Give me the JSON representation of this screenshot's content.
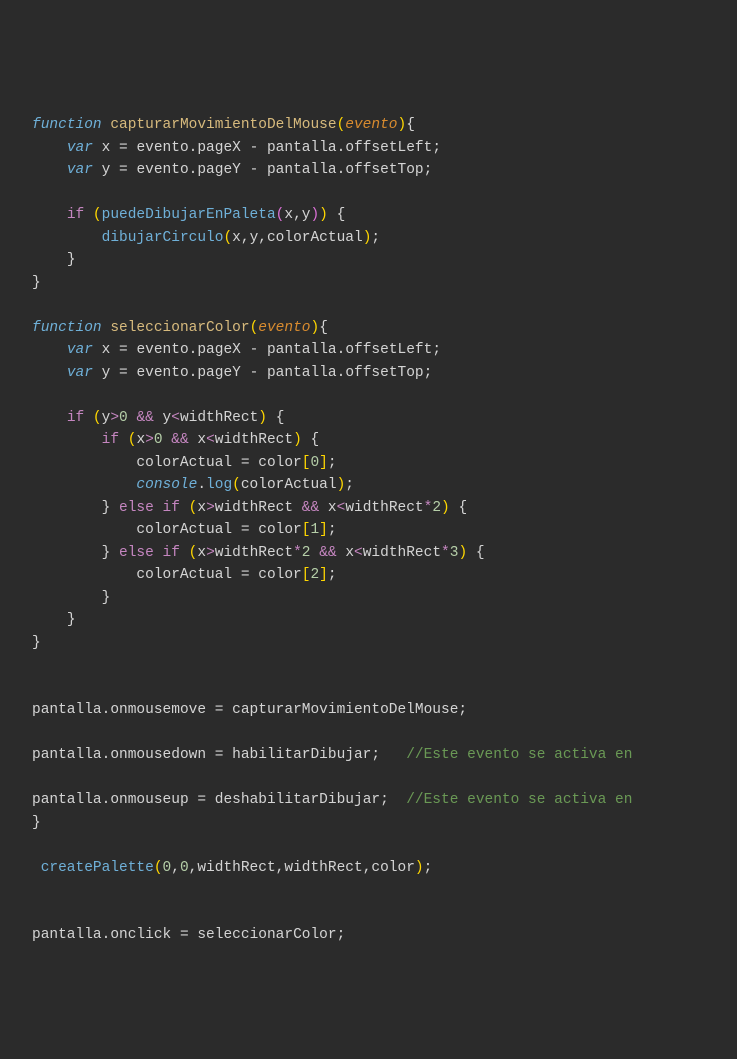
{
  "code": {
    "fn1": {
      "kw_function": "function",
      "name": "capturarMovimientoDelMouse",
      "param": "evento",
      "l2_var": "var",
      "l2_x": "x",
      "l2_eq": " = ",
      "l2_evento": "evento",
      "l2_dot1": ".",
      "l2_pageX": "pageX",
      "l2_minus": " - ",
      "l2_pantalla": "pantalla",
      "l2_dot2": ".",
      "l2_offsetLeft": "offsetLeft",
      "l2_semi": ";",
      "l3_var": "var",
      "l3_y": "y",
      "l3_evento": "evento",
      "l3_pageY": "pageY",
      "l3_pantalla": "pantalla",
      "l3_offsetTop": "offsetTop",
      "l5_if": "if",
      "l5_fn": "puedeDibujarEnPaleta",
      "l5_x": "x",
      "l5_comma": ",",
      "l5_y": "y",
      "l6_fn": "dibujarCirculo",
      "l6_x": "x",
      "l6_y": "y",
      "l6_colorActual": "colorActual"
    },
    "fn2": {
      "kw_function": "function",
      "name": "seleccionarColor",
      "param": "evento",
      "l2_var": "var",
      "l2_x": "x",
      "l2_evento": "evento",
      "l2_pageX": "pageX",
      "l2_pantalla": "pantalla",
      "l2_offsetLeft": "offsetLeft",
      "l3_var": "var",
      "l3_y": "y",
      "l3_evento": "evento",
      "l3_pageY": "pageY",
      "l3_pantalla": "pantalla",
      "l3_offsetTop": "offsetTop",
      "l5_if": "if",
      "l5_y1": "y",
      "l5_gt": ">",
      "l5_zero": "0",
      "l5_and": "&&",
      "l5_y2": "y",
      "l5_lt": "<",
      "l5_widthRect": "widthRect",
      "l6_if": "if",
      "l6_x1": "x",
      "l6_zero": "0",
      "l6_x2": "x",
      "l6_widthRect": "widthRect",
      "l7_colorActual": "colorActual",
      "l7_color": "color",
      "l7_idx": "0",
      "l8_console": "console",
      "l8_log": "log",
      "l8_arg": "colorActual",
      "l9_else": "else",
      "l9_if": "if",
      "l9_x1": "x",
      "l9_widthRect1": "widthRect",
      "l9_x2": "x",
      "l9_widthRect2": "widthRect",
      "l9_mul": "*",
      "l9_two": "2",
      "l10_colorActual": "colorActual",
      "l10_color": "color",
      "l10_idx": "1",
      "l11_else": "else",
      "l11_if": "if",
      "l11_x1": "x",
      "l11_widthRect1": "widthRect",
      "l11_two": "2",
      "l11_x2": "x",
      "l11_widthRect2": "widthRect",
      "l11_three": "3",
      "l12_colorActual": "colorActual",
      "l12_color": "color",
      "l12_idx": "2"
    },
    "tail": {
      "l1_pantalla": "pantalla",
      "l1_onmousemove": "onmousemove",
      "l1_fn": "capturarMovimientoDelMouse",
      "l2_pantalla": "pantalla",
      "l2_onmousedown": "onmousedown",
      "l2_fn": "habilitarDibujar",
      "l2_comment": "//Este evento se activa en",
      "l3_pantalla": "pantalla",
      "l3_onmouseup": "onmouseup",
      "l3_fn": "deshabilitarDibujar",
      "l3_comment": "//Este evento se activa en",
      "l5_fn": "createPalette",
      "l5_a": "0",
      "l5_b": "0",
      "l5_c": "widthRect",
      "l5_d": "widthRect",
      "l5_e": "color",
      "l6_pantalla": "pantalla",
      "l6_onclick": "onclick",
      "l6_fn": "seleccionarColor"
    }
  }
}
